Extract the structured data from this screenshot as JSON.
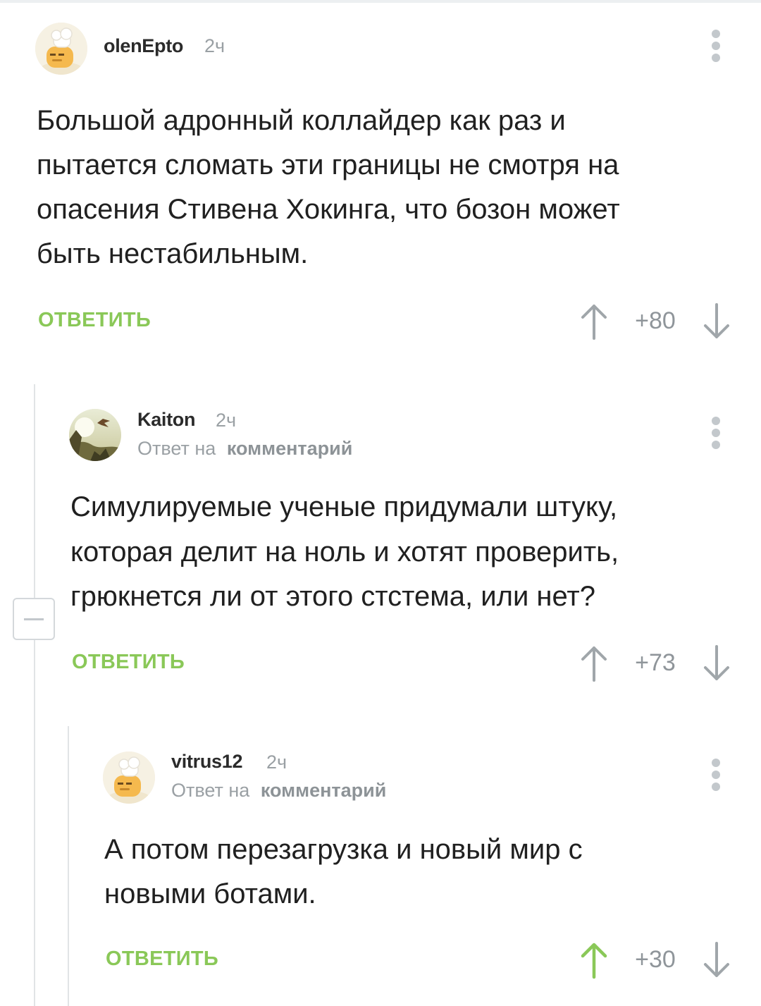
{
  "comments": [
    {
      "username": "olenEpto",
      "time": "2ч",
      "lines": [
        "Большой адронный коллайдер как раз и",
        "пытается сломать эти границы не смотря на",
        "опасения Стивена Хокинга, что бозон может",
        "быть нестабильным."
      ],
      "reply_label": "ОТВЕТИТЬ",
      "rating": "+80",
      "upvoted": false
    },
    {
      "username": "Kaiton",
      "time": "2ч",
      "reply_prefix": "Ответ на",
      "reply_target": "комментарий",
      "lines": [
        "Симулируемые ученые придумали штуку,",
        "которая делит на ноль и хотят проверить,",
        "грюкнется ли от этого стстема, или нет?"
      ],
      "reply_label": "ОТВЕТИТЬ",
      "rating": "+73",
      "upvoted": false
    },
    {
      "username": "vitrus12",
      "time": "2ч",
      "reply_prefix": "Ответ на",
      "reply_target": "комментарий",
      "lines": [
        "А потом перезагрузка и новый мир с",
        "новыми ботами."
      ],
      "reply_label": "ОТВЕТИТЬ",
      "rating": "+30",
      "upvoted": true
    }
  ],
  "colors": {
    "accent_green": "#8ac858",
    "muted_gray": "#9aa0a4",
    "vote_gray": "#a0a6aa"
  },
  "icons": {
    "more": "vertical-dots-icon",
    "upvote": "arrow-up-icon",
    "downvote": "arrow-down-icon",
    "collapse": "minus-icon"
  }
}
